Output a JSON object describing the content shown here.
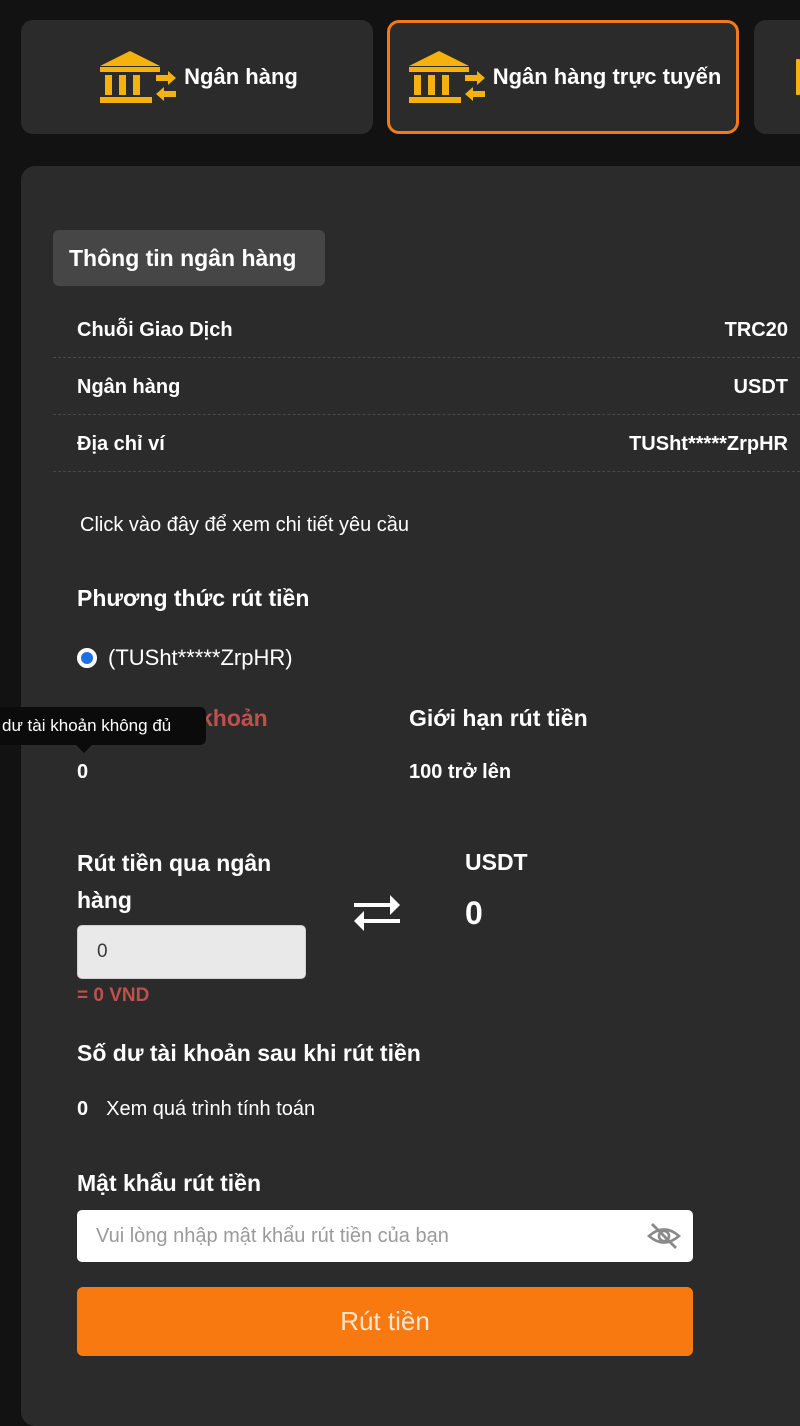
{
  "tabs": [
    {
      "label": "Ngân hàng",
      "icon": "bank-transfer-icon"
    },
    {
      "label": "Ngân hàng trực tuyến",
      "icon": "bank-transfer-icon",
      "active": true
    }
  ],
  "colors": {
    "accent": "#f7790f",
    "icon_gold": "#f5b20f",
    "error": "#c0504d",
    "panel": "#2b2b2b",
    "background": "#121212"
  },
  "bank_info": {
    "header": "Thông tin ngân hàng",
    "rows": [
      {
        "label": "Chuỗi Giao Dịch",
        "value": "TRC20"
      },
      {
        "label": "Ngân hàng",
        "value": "USDT"
      },
      {
        "label": "Địa chỉ ví",
        "value": "TUSht*****ZrpHR"
      }
    ]
  },
  "detail_link": "Click vào đây để xem chi tiết yêu cầu",
  "withdraw_method": {
    "title": "Phương thức rút tiền",
    "option": "(TUSht*****ZrpHR)",
    "selected": true
  },
  "balance": {
    "label_visible": "khoản",
    "value": "0",
    "tooltip": "dư tài khoản không đủ"
  },
  "limit": {
    "label": "Giới hạn rút tiền",
    "value": "100 trở lên"
  },
  "withdraw": {
    "label": "Rút tiền qua ngân hàng",
    "input_value": "0",
    "vnd_equivalent": "= 0 VND",
    "currency": "USDT",
    "converted_value": "0",
    "swap_icon": "swap-arrows-icon"
  },
  "after_balance": {
    "title": "Số dư tài khoản sau khi rút tiền",
    "value": "0",
    "link": "Xem quá trình tính toán"
  },
  "password": {
    "title": "Mật khẩu rút tiền",
    "placeholder": "Vui lòng nhập mật khẩu rút tiền của bạn",
    "icon": "eye-off-icon"
  },
  "submit_label": "Rút tiền"
}
